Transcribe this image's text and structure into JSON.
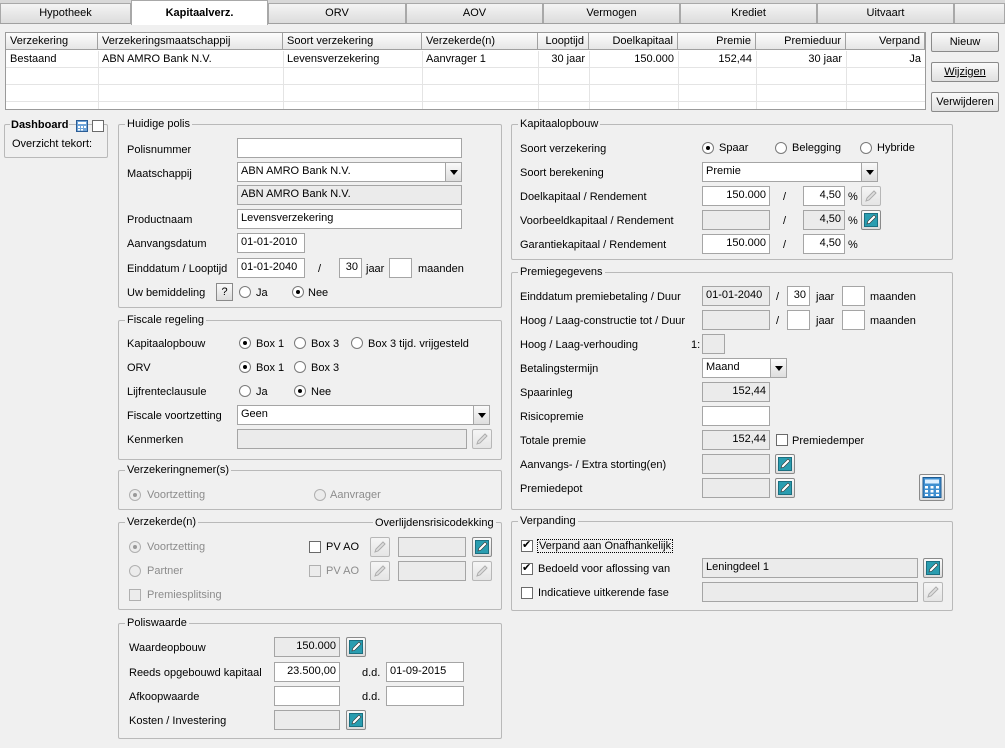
{
  "tabs": [
    "Hypotheek",
    "Kapitaalverz.",
    "ORV",
    "AOV",
    "Vermogen",
    "Krediet",
    "Uitvaart"
  ],
  "table": {
    "headers": [
      "Verzekering",
      "Verzekeringsmaatschappij",
      "Soort verzekering",
      "Verzekerde(n)",
      "Looptijd",
      "Doelkapitaal",
      "Premie",
      "Premieduur",
      "Verpand"
    ],
    "rows": [
      [
        "Bestaand",
        "ABN AMRO Bank N.V.",
        "Levensverzekering",
        "Aanvrager 1",
        "30 jaar",
        "150.000",
        "152,44",
        "30 jaar",
        "Ja"
      ]
    ]
  },
  "buttons": {
    "nieuw": "Nieuw",
    "wijzigen": "Wijzigen",
    "verwijderen": "Verwijderen"
  },
  "dashboard": {
    "title": "Dashboard",
    "subtitle": "Overzicht tekort:"
  },
  "huidige_polis": {
    "title": "Huidige polis",
    "polisnummer_label": "Polisnummer",
    "polisnummer": "",
    "maatschappij_label": "Maatschappij",
    "maatschappij": "ABN AMRO Bank N.V.",
    "maatschappij_display": "ABN AMRO Bank N.V.",
    "productnaam_label": "Productnaam",
    "productnaam": "Levensverzekering",
    "aanvangsdatum_label": "Aanvangsdatum",
    "aanvangsdatum": "01-01-2010",
    "einddatum_label": "Einddatum / Looptijd",
    "einddatum": "01-01-2040",
    "slash": "/",
    "looptijd_jaar": "30",
    "jaar_label": "jaar",
    "looptijd_maanden": "",
    "maanden_label": "maanden",
    "bemiddeling_label": "Uw bemiddeling",
    "help": "?",
    "ja": "Ja",
    "nee": "Nee"
  },
  "fiscale_regeling": {
    "title": "Fiscale regeling",
    "kapitaalopbouw_label": "Kapitaalopbouw",
    "box1": "Box 1",
    "box3": "Box 3",
    "box3_vrij": "Box 3 tijd. vrijgesteld",
    "orv_label": "ORV",
    "orv_box1": "Box 1",
    "orv_box3": "Box 3",
    "lijfrente_label": "Lijfrenteclausule",
    "ja": "Ja",
    "nee": "Nee",
    "voortzetting_label": "Fiscale voortzetting",
    "voortzetting": "Geen",
    "kenmerken_label": "Kenmerken",
    "kenmerken": ""
  },
  "verzekeringnemers": {
    "title": "Verzekeringnemer(s)",
    "voortzetting": "Voortzetting",
    "aanvrager": "Aanvrager"
  },
  "verzekerden": {
    "title": "Verzekerde(n)",
    "overlijden_title": "Overlijdensrisicodekking",
    "voortzetting": "Voortzetting",
    "partner": "Partner",
    "premiesplitsing": "Premiesplitsing",
    "pvao": "PV AO"
  },
  "poliswaarde": {
    "title": "Poliswaarde",
    "waardeopbouw_label": "Waardeopbouw",
    "waardeopbouw": "150.000",
    "opgebouwd_label": "Reeds opgebouwd kapitaal",
    "opgebouwd": "23.500,00",
    "dd": "d.d.",
    "opgebouwd_datum": "01-09-2015",
    "afkoop_label": "Afkoopwaarde",
    "afkoop": "",
    "afkoop_datum": "",
    "kosten_label": "Kosten / Investering",
    "kosten": ""
  },
  "kapitaalopbouw": {
    "title": "Kapitaalopbouw",
    "soort_label": "Soort verzekering",
    "spaar": "Spaar",
    "belegging": "Belegging",
    "hybride": "Hybride",
    "berekening_label": "Soort berekening",
    "berekening": "Premie",
    "doel_label": "Doelkapitaal / Rendement",
    "doel": "150.000",
    "doel_rend": "4,50",
    "voorbeeld_label": "Voorbeeldkapitaal / Rendement",
    "voorbeeld": "",
    "voorbeeld_rend": "4,50",
    "garantie_label": "Garantiekapitaal / Rendement",
    "garantie": "150.000",
    "garantie_rend": "4,50",
    "slash": "/",
    "pct": "%"
  },
  "premiegegevens": {
    "title": "Premiegegevens",
    "einddatum_label": "Einddatum premiebetaling / Duur",
    "einddatum": "01-01-2040",
    "duur_jaar": "30",
    "duur_maanden": "",
    "jaar": "jaar",
    "maanden": "maanden",
    "hooglaag_label": "Hoog / Laag-constructie tot / Duur",
    "hooglaag": "",
    "hl_jaar": "",
    "hl_maanden": "",
    "verhouding_label": "Hoog / Laag-verhouding",
    "verhouding_prefix": "1:",
    "verhouding": "",
    "termijn_label": "Betalingstermijn",
    "termijn": "Maand",
    "spaarinleg_label": "Spaarinleg",
    "spaarinleg": "152,44",
    "risico_label": "Risicopremie",
    "risico": "",
    "totaal_label": "Totale premie",
    "totaal": "152,44",
    "premiedemper": "Premiedemper",
    "storting_label": "Aanvangs- / Extra storting(en)",
    "storting": "",
    "depot_label": "Premiedepot",
    "depot": "",
    "slash": "/"
  },
  "verpanding": {
    "title": "Verpanding",
    "verpand": "Verpand aan Onafhankelijk",
    "aflossing": "Bedoeld voor aflossing van",
    "aflossing_value": "Leningdeel 1",
    "indicatief": "Indicatieve uitkerende fase",
    "indicatief_value": ""
  }
}
